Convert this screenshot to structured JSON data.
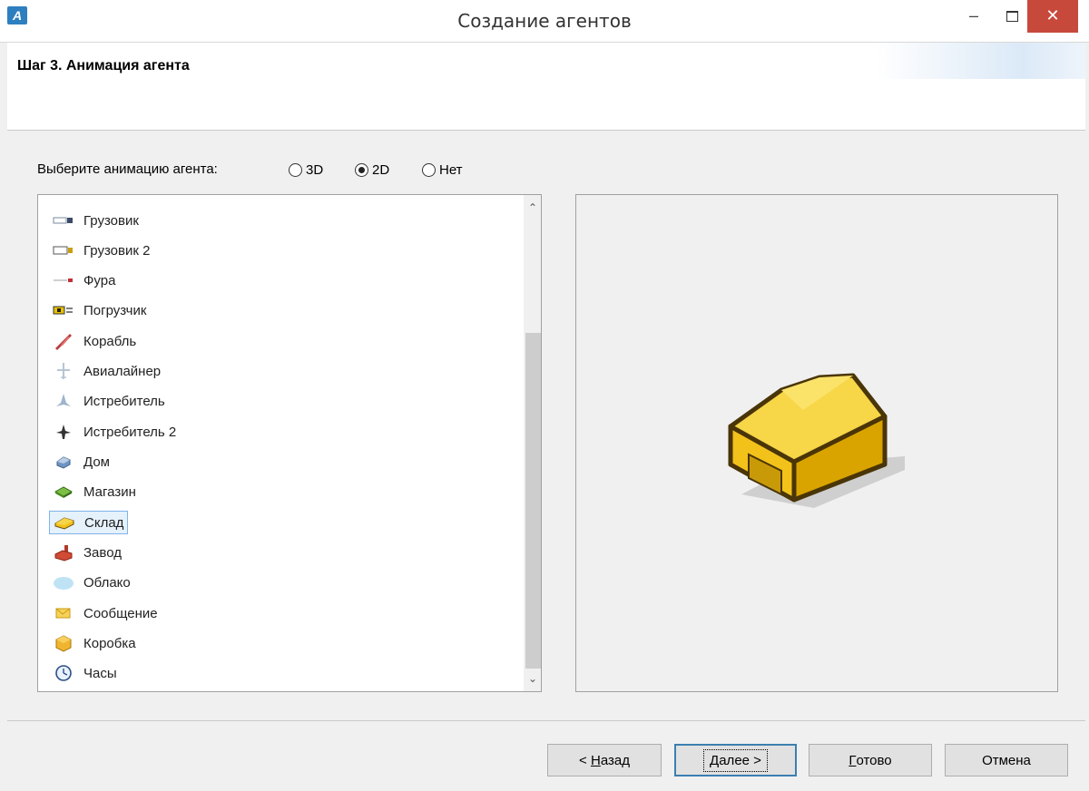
{
  "window": {
    "title": "Создание агентов",
    "app_icon_text": "A",
    "min_symbol": "–",
    "close_symbol": "✕"
  },
  "header": {
    "step_title": "Шаг 3. Анимация агента"
  },
  "animation_choice": {
    "label": "Выберите анимацию агента:",
    "options": [
      {
        "label": "3D",
        "checked": false
      },
      {
        "label": "2D",
        "checked": true
      },
      {
        "label": "Нет",
        "checked": false
      }
    ]
  },
  "list": {
    "selected": "Склад",
    "items": [
      {
        "label": "Грузовик",
        "icon": "truck-icon"
      },
      {
        "label": "Грузовик 2",
        "icon": "truck-2-icon"
      },
      {
        "label": "Фура",
        "icon": "lorry-icon"
      },
      {
        "label": "Погрузчик",
        "icon": "forklift-icon"
      },
      {
        "label": "Корабль",
        "icon": "ship-icon"
      },
      {
        "label": "Авиалайнер",
        "icon": "airliner-icon"
      },
      {
        "label": "Истребитель",
        "icon": "fighter-icon"
      },
      {
        "label": "Истребитель 2",
        "icon": "fighter-2-icon"
      },
      {
        "label": "Дом",
        "icon": "house-icon"
      },
      {
        "label": "Магазин",
        "icon": "shop-icon"
      },
      {
        "label": "Склад",
        "icon": "warehouse-icon"
      },
      {
        "label": "Завод",
        "icon": "factory-icon"
      },
      {
        "label": "Облако",
        "icon": "cloud-icon"
      },
      {
        "label": "Сообщение",
        "icon": "message-icon"
      },
      {
        "label": "Коробка",
        "icon": "box-icon"
      },
      {
        "label": "Часы",
        "icon": "clock-icon"
      }
    ]
  },
  "preview": {
    "icon": "warehouse-preview-icon",
    "colors": {
      "fill": "#f2c21a",
      "dark": "#d9a400",
      "outline": "#4a3508",
      "shadow": "#cfcfcf"
    }
  },
  "buttons": {
    "back_prefix": "< ",
    "back_hotkey": "Н",
    "back_rest": "азад",
    "next_hotkey": "Д",
    "next_rest": "алее >",
    "finish_hotkey": "Г",
    "finish_rest": "отово",
    "cancel": "Отмена"
  },
  "colors": {
    "close_button": "#c7493b",
    "selection_bg": "#e5f1fb",
    "selection_border": "#7eb4ea"
  }
}
